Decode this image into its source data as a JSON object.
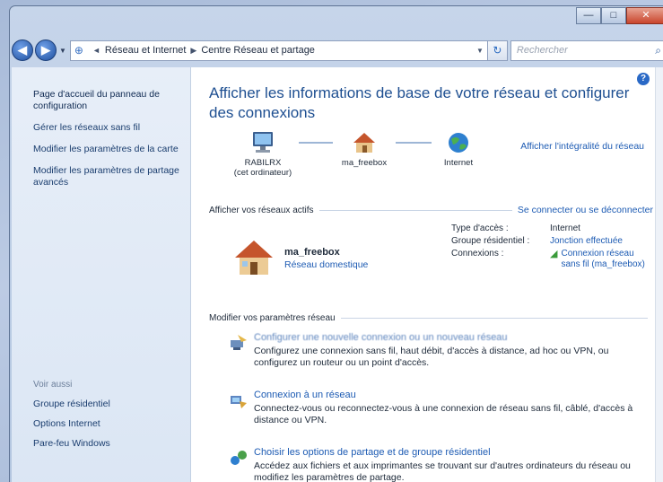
{
  "window": {
    "caption": {
      "minimize": "—",
      "maximize": "□",
      "close": "✕"
    }
  },
  "nav": {
    "back_icon": "back-arrow-icon",
    "forward_icon": "forward-arrow-icon",
    "breadcrumb": [
      "Réseau et Internet",
      "Centre Réseau et partage"
    ],
    "search_placeholder": "Rechercher"
  },
  "sidebar": {
    "links": [
      "Page d'accueil du panneau de configuration",
      "Gérer les réseaux sans fil",
      "Modifier les paramètres de la carte",
      "Modifier les paramètres de partage avancés"
    ],
    "see_also_header": "Voir aussi",
    "see_also": [
      "Groupe résidentiel",
      "Options Internet",
      "Pare-feu Windows"
    ]
  },
  "main": {
    "title": "Afficher les informations de base de votre réseau et configurer des connexions",
    "full_map_link": "Afficher l'intégralité du réseau",
    "nodes": [
      {
        "label": "RABILRX",
        "sub": "(cet ordinateur)"
      },
      {
        "label": "ma_freebox",
        "sub": ""
      },
      {
        "label": "Internet",
        "sub": ""
      }
    ],
    "active_header": "Afficher vos réseaux actifs",
    "connect_link": "Se connecter ou se déconnecter",
    "network": {
      "name": "ma_freebox",
      "type": "Réseau domestique"
    },
    "props": {
      "access_key": "Type d'accès :",
      "access_val": "Internet",
      "group_key": "Groupe résidentiel :",
      "group_val": "Jonction effectuée",
      "conn_key": "Connexions :",
      "conn_val": "Connexion réseau sans fil (ma_freebox)"
    },
    "tasks_header": "Modifier vos paramètres réseau",
    "tasks": [
      {
        "link": "Configurer une nouvelle connexion ou un nouveau réseau",
        "desc": "Configurez une connexion sans fil, haut débit, d'accès à distance, ad hoc ou VPN, ou configurez un routeur ou un point d'accès."
      },
      {
        "link": "Connexion à un réseau",
        "desc": "Connectez-vous ou reconnectez-vous à une connexion de réseau sans fil, câblé, d'accès à distance ou VPN."
      },
      {
        "link": "Choisir les options de partage et de groupe résidentiel",
        "desc": "Accédez aux fichiers et aux imprimantes se trouvant sur d'autres ordinateurs du réseau ou modifiez les paramètres de partage."
      }
    ]
  }
}
